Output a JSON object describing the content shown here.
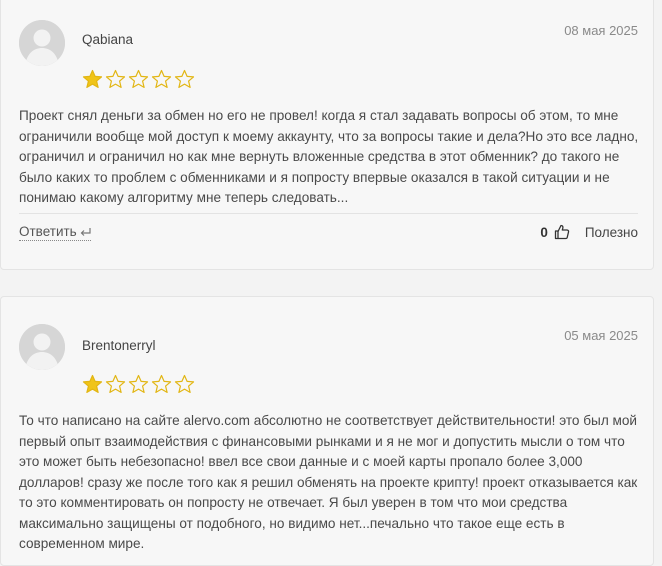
{
  "reviews": [
    {
      "author": "Qabiana",
      "date": "08 мая 2025",
      "rating": 1,
      "max_rating": 5,
      "text": "Проект снял деньги за обмен но его не провел! когда я стал задавать вопросы об этом, то мне ограничили вообще мой доступ к моему аккаунту, что за вопросы такие и дела?Но это все ладно, ограничил и ограничил но как мне вернуть вложенные средства в этот обменник? до такого не было каких то проблем с обменниками и я попросту впервые оказался в такой ситуации и не понимаю какому алгоритму мне теперь следовать...",
      "reply_label": "Ответить",
      "helpful_count": "0",
      "helpful_label": "Полезно"
    },
    {
      "author": "Brentonerryl",
      "date": "05 мая 2025",
      "rating": 1,
      "max_rating": 5,
      "text": "То что написано на сайте alervo.com абсолютно не соответствует действительности! это был мой первый опыт взаимодействия с финансовыми рынками и я не мог и допустить мысли о том что это может быть небезопасно! ввел все свои данные и с моей карты пропало более 3,000 долларов! сразу же после того как я решил обменять на проекте крипту! проект отказывается как то это комментировать он попросту не отвечает. Я был уверен в том что мои средства максимально защищены от подобного, но видимо нет...печально что такое еще есть в современном мире."
    }
  ],
  "colors": {
    "star_fill": "#f0c419",
    "star_outline": "#e2b614"
  }
}
